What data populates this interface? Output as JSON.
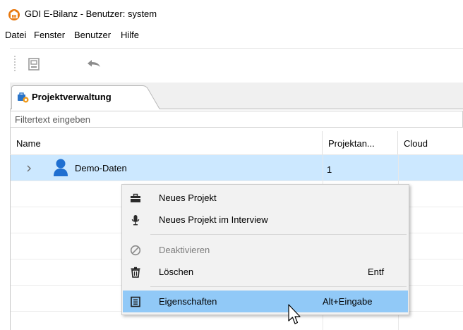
{
  "window": {
    "title": "GDI E-Bilanz - Benutzer: system",
    "app_icon": "gdi-logo-icon"
  },
  "menubar": {
    "items": [
      "Datei",
      "Fenster",
      "Benutzer",
      "Hilfe"
    ]
  },
  "toolbar": {
    "buttons": [
      {
        "name": "save",
        "icon": "save-icon",
        "enabled": false
      },
      {
        "name": "undo",
        "icon": "undo-icon",
        "enabled": false
      }
    ]
  },
  "tab": {
    "label": "Projektverwaltung",
    "icon": "project-management-icon"
  },
  "filter": {
    "placeholder": "Filtertext eingeben",
    "value": ""
  },
  "table": {
    "columns": [
      "Name",
      "Projektan...",
      "Cloud"
    ],
    "rows": [
      {
        "name": "Demo-Daten",
        "count": "1",
        "cloud": "",
        "icon": "user-icon",
        "expanded": false,
        "selected": true
      }
    ]
  },
  "context_menu": {
    "items": [
      {
        "label": "Neues Projekt",
        "icon": "briefcase-icon",
        "shortcut": "",
        "enabled": true
      },
      {
        "label": "Neues Projekt im Interview",
        "icon": "microphone-icon",
        "shortcut": "",
        "enabled": true
      },
      {
        "label": "Deaktivieren",
        "icon": "disabled-icon",
        "shortcut": "",
        "enabled": false
      },
      {
        "label": "Löschen",
        "icon": "trash-icon",
        "shortcut": "Entf",
        "enabled": true
      },
      {
        "label": "Eigenschaften",
        "icon": "properties-icon",
        "shortcut": "Alt+Eingabe",
        "enabled": true,
        "highlighted": true
      }
    ]
  },
  "colors": {
    "selection": "#cce8ff",
    "menu_highlight": "#91c9f7",
    "user_icon": "#1f6fd1",
    "app_icon": "#e8780e"
  }
}
